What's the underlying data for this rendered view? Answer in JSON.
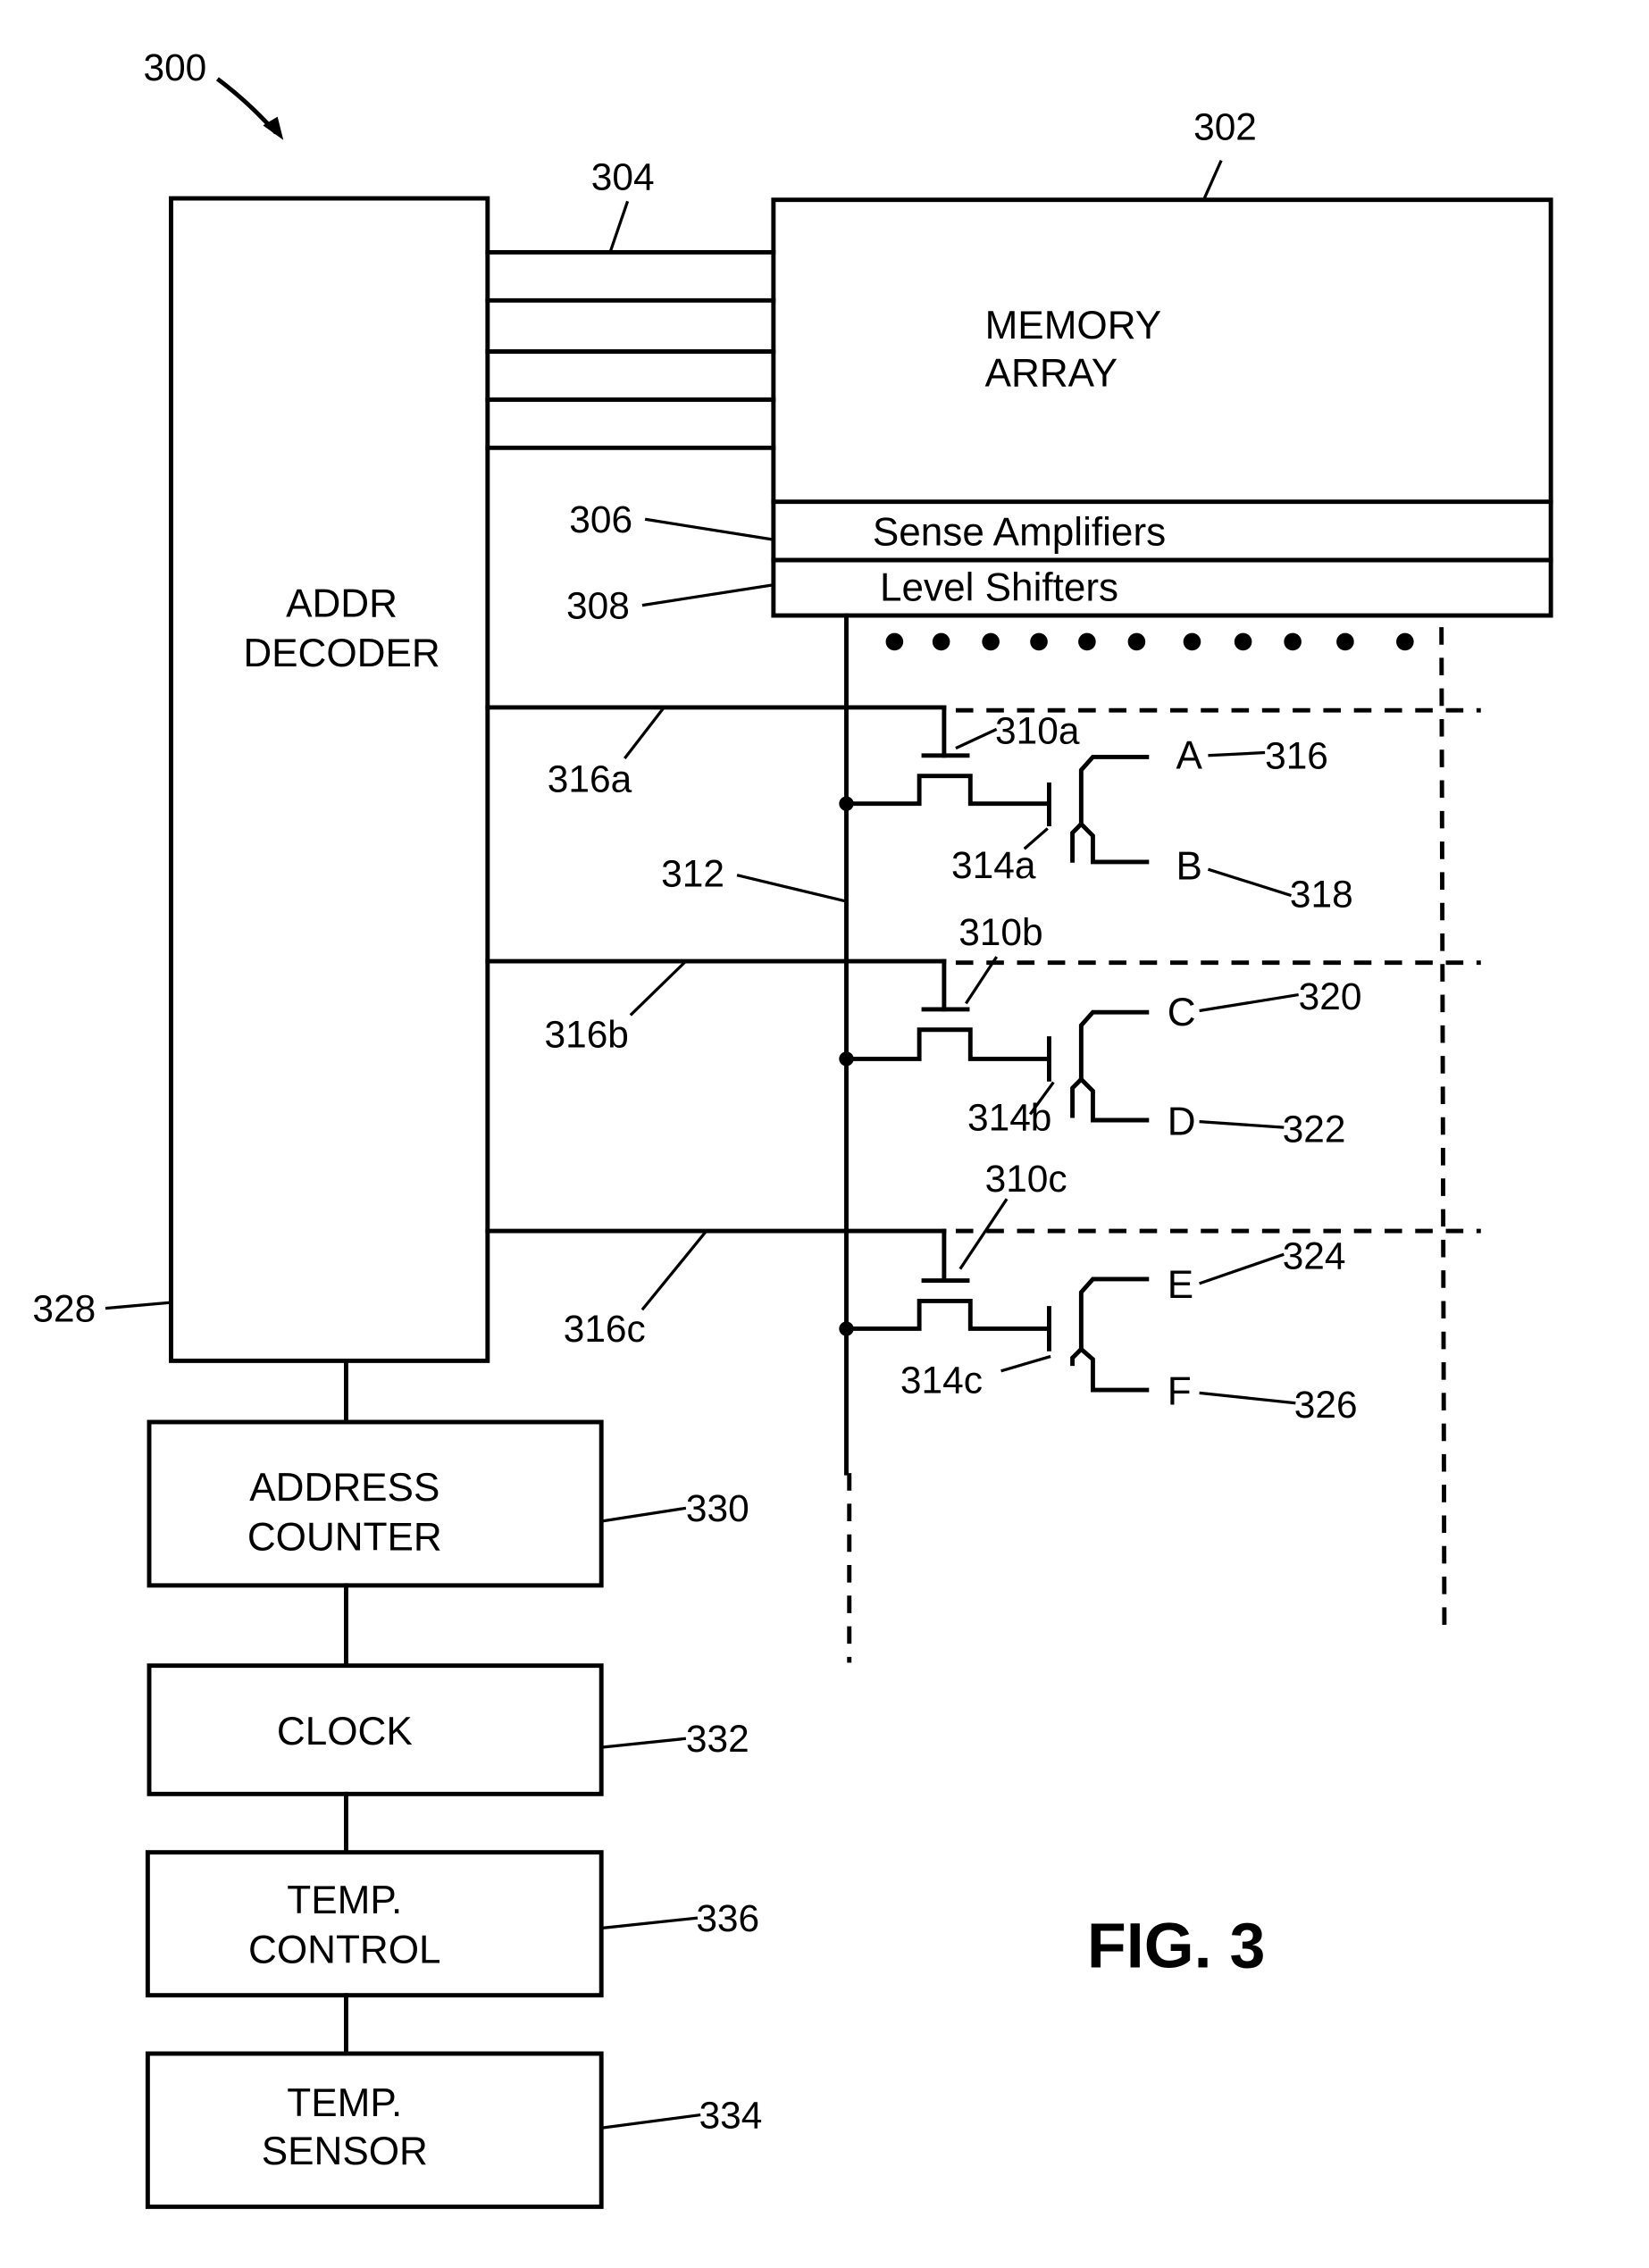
{
  "figure": {
    "caption": "FIG. 3",
    "ref": "300"
  },
  "blocks": {
    "memory_array": {
      "line1": "MEMORY",
      "line2": "ARRAY",
      "ref": "302"
    },
    "sense_amplifiers": {
      "label": "Sense Amplifiers",
      "ref": "306"
    },
    "level_shifters": {
      "label": "Level Shifters",
      "ref": "308"
    },
    "addr_decoder": {
      "line1": "ADDR",
      "line2": "DECODER",
      "ref": "328"
    },
    "address_counter": {
      "line1": "ADDRESS",
      "line2": "COUNTER",
      "ref": "330"
    },
    "clock": {
      "line1": "CLOCK",
      "ref": "332"
    },
    "temp_control": {
      "line1": "TEMP.",
      "line2": "CONTROL",
      "ref": "336"
    },
    "temp_sensor": {
      "line1": "TEMP.",
      "line2": "SENSOR",
      "ref": "334"
    }
  },
  "wordlines_ref": "304",
  "bitline_ref": "312",
  "cells": [
    {
      "select_line": "316a",
      "transistor": "310a",
      "switch": "314a",
      "node_top": "A",
      "node_top_ref": "316",
      "node_bottom": "B",
      "node_bottom_ref": "318"
    },
    {
      "select_line": "316b",
      "transistor": "310b",
      "switch": "314b",
      "node_top": "C",
      "node_top_ref": "320",
      "node_bottom": "D",
      "node_bottom_ref": "322"
    },
    {
      "select_line": "316c",
      "transistor": "310c",
      "switch": "314c",
      "node_top": "E",
      "node_top_ref": "324",
      "node_bottom": "F",
      "node_bottom_ref": "326"
    }
  ]
}
